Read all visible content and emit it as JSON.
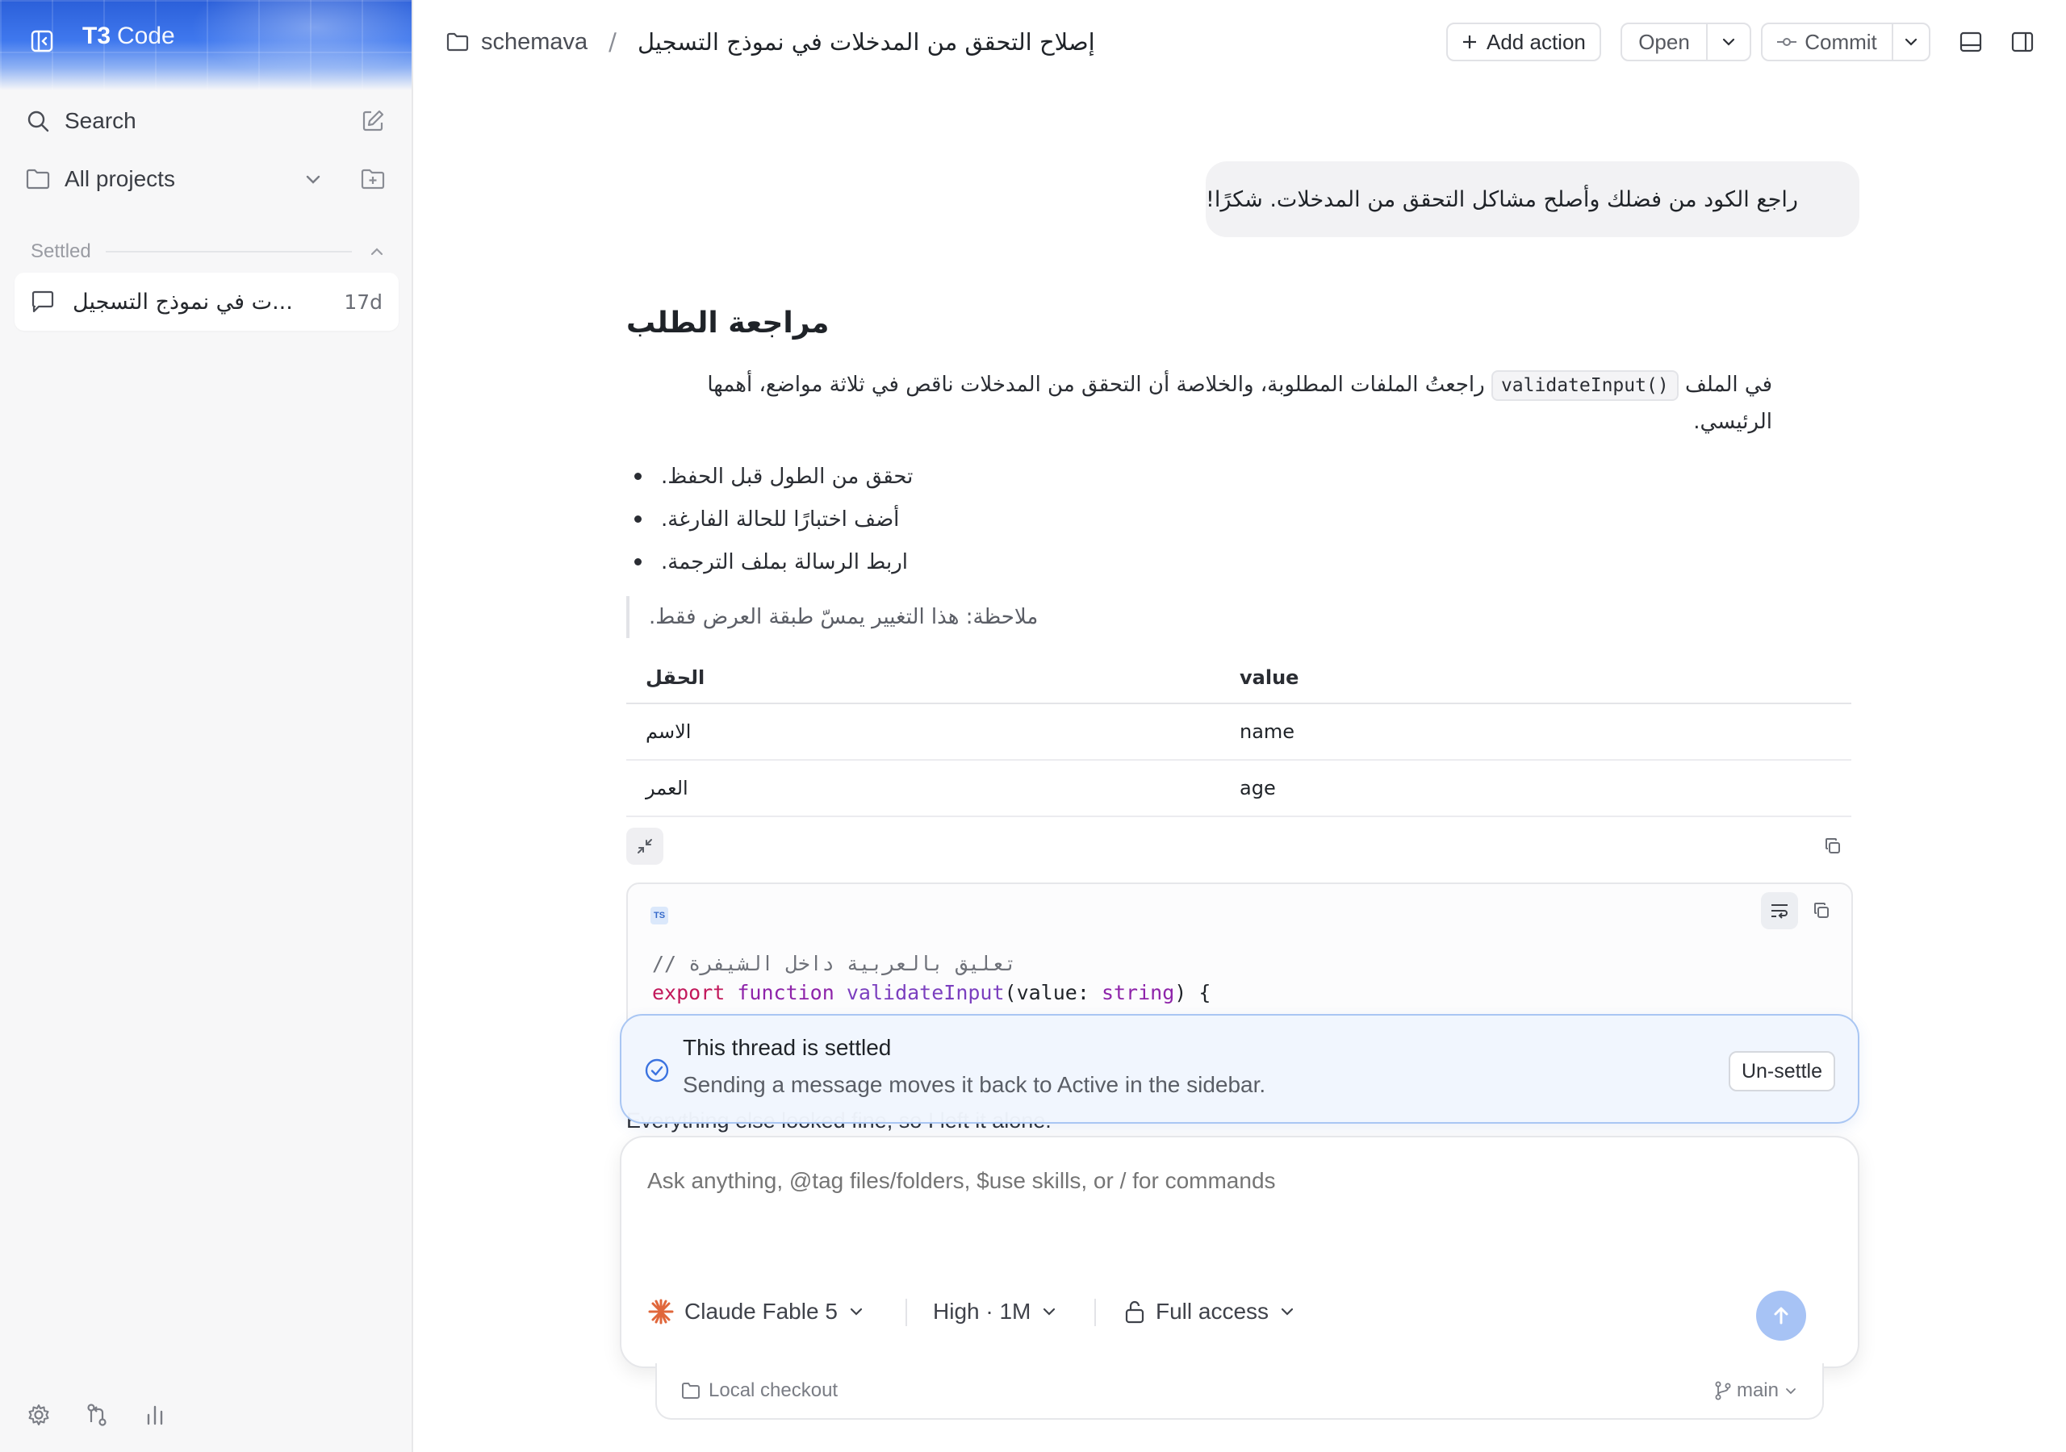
{
  "app": {
    "brand_bold": "T3",
    "brand_light": "Code"
  },
  "sidebar": {
    "search_label": "Search",
    "projects_label": "All projects",
    "section_label": "Settled",
    "threads": [
      {
        "title": "إصلاح التحقق من المدخلات في نموذج التسجيل",
        "title_shown": "...ت في نموذج التسجيل",
        "age": "17d"
      }
    ]
  },
  "header": {
    "project": "schemava",
    "separator": "/",
    "thread_title": "إصلاح التحقق من المدخلات في نموذج التسجيل",
    "add_action_label": "Add action",
    "open_label": "Open",
    "commit_label": "Commit"
  },
  "conversation": {
    "user_message": "راجع الكود من فضلك وأصلح مشاكل التحقق من المدخلات. شكرًا!",
    "assistant": {
      "heading": "مراجعة الطلب",
      "para_before_code": "في الملف",
      "code_inline": "validateInput()",
      "para_after_code": "راجعتُ الملفات المطلوبة، والخلاصة أن التحقق من المدخلات ناقص في ثلاثة مواضع، أهمها الرئيسي.",
      "bullets": [
        "تحقق من الطول قبل الحفظ.",
        "أضف اختبارًا للحالة الفارغة.",
        "اربط الرسالة بملف الترجمة."
      ],
      "quote": "ملاحظة: هذا التغيير يمسّ طبقة العرض فقط.",
      "table": {
        "headers": [
          "الحقل",
          "value"
        ],
        "rows": [
          [
            "الاسم",
            "name"
          ],
          [
            "العمر",
            "age"
          ]
        ]
      },
      "code": {
        "lang_badge": "TS",
        "comment": "// تعليق بالعربية داخل الشيفرة",
        "line2_kw1": "export",
        "line2_kw2": "function",
        "line2_fn": "validateInput",
        "line2_open": "(value: ",
        "line2_type": "string",
        "line2_close": ") {"
      },
      "trailing_text": "Everything else looked fine, so I left it alone."
    }
  },
  "settled_banner": {
    "title": "This thread is settled",
    "subtitle": "Sending a message moves it back to Active in the sidebar.",
    "button": "Un-settle"
  },
  "composer": {
    "placeholder": "Ask anything, @tag files/folders, $use skills, or / for commands",
    "model": "Claude Fable 5",
    "effort": "High · 1M",
    "access": "Full access"
  },
  "checkout": {
    "left": "Local checkout",
    "branch": "main"
  },
  "colors": {
    "accent": "#3f78ee",
    "send": "#a7c3f5",
    "model_star": "#e0673b"
  }
}
